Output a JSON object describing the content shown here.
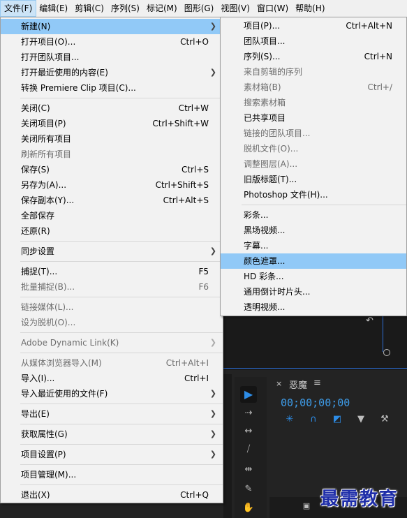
{
  "menubar": [
    {
      "label": "文件(F)",
      "active": true
    },
    {
      "label": "编辑(E)"
    },
    {
      "label": "剪辑(C)"
    },
    {
      "label": "序列(S)"
    },
    {
      "label": "标记(M)"
    },
    {
      "label": "图形(G)"
    },
    {
      "label": "视图(V)"
    },
    {
      "label": "窗口(W)"
    },
    {
      "label": "帮助(H)"
    }
  ],
  "file_menu": {
    "new": {
      "label": "新建(N)"
    },
    "open_project": {
      "label": "打开项目(O)...",
      "shortcut": "Ctrl+O"
    },
    "open_team_project": {
      "label": "打开团队项目..."
    },
    "open_recent": {
      "label": "打开最近使用的内容(E)"
    },
    "convert_clip": {
      "label": "转换 Premiere Clip 项目(C)..."
    },
    "close": {
      "label": "关闭(C)",
      "shortcut": "Ctrl+W"
    },
    "close_project": {
      "label": "关闭项目(P)",
      "shortcut": "Ctrl+Shift+W"
    },
    "close_all_projects": {
      "label": "关闭所有项目"
    },
    "refresh_all_projects": {
      "label": "刷新所有项目"
    },
    "save": {
      "label": "保存(S)",
      "shortcut": "Ctrl+S"
    },
    "save_as": {
      "label": "另存为(A)...",
      "shortcut": "Ctrl+Shift+S"
    },
    "save_copy": {
      "label": "保存副本(Y)...",
      "shortcut": "Ctrl+Alt+S"
    },
    "save_all": {
      "label": "全部保存"
    },
    "revert": {
      "label": "还原(R)"
    },
    "sync_settings": {
      "label": "同步设置"
    },
    "capture": {
      "label": "捕捉(T)...",
      "shortcut": "F5"
    },
    "batch_capture": {
      "label": "批量捕捉(B)...",
      "shortcut": "F6"
    },
    "link_media": {
      "label": "链接媒体(L)..."
    },
    "make_offline": {
      "label": "设为脱机(O)..."
    },
    "dynamic_link": {
      "label": "Adobe Dynamic Link(K)"
    },
    "import_media_browser": {
      "label": "从媒体浏览器导入(M)",
      "shortcut": "Ctrl+Alt+I"
    },
    "import": {
      "label": "导入(I)...",
      "shortcut": "Ctrl+I"
    },
    "import_recent": {
      "label": "导入最近使用的文件(F)"
    },
    "export": {
      "label": "导出(E)"
    },
    "get_properties": {
      "label": "获取属性(G)"
    },
    "project_settings": {
      "label": "项目设置(P)"
    },
    "project_manager": {
      "label": "项目管理(M)..."
    },
    "exit": {
      "label": "退出(X)",
      "shortcut": "Ctrl+Q"
    }
  },
  "new_submenu": {
    "project": {
      "label": "项目(P)...",
      "shortcut": "Ctrl+Alt+N"
    },
    "team_project": {
      "label": "团队项目..."
    },
    "sequence": {
      "label": "序列(S)...",
      "shortcut": "Ctrl+N"
    },
    "sequence_from_clip": {
      "label": "来自剪辑的序列"
    },
    "bin": {
      "label": "素材箱(B)",
      "shortcut": "Ctrl+/"
    },
    "search_bin": {
      "label": "搜索素材箱"
    },
    "shared_project": {
      "label": "已共享项目"
    },
    "linked_team_project": {
      "label": "链接的团队项目..."
    },
    "offline_file": {
      "label": "脱机文件(O)..."
    },
    "adjustment_layer": {
      "label": "调整图层(A)..."
    },
    "legacy_title": {
      "label": "旧版标题(T)..."
    },
    "photoshop_file": {
      "label": "Photoshop 文件(H)..."
    },
    "bars_tone": {
      "label": "彩条..."
    },
    "black_video": {
      "label": "黑场视频..."
    },
    "captions": {
      "label": "字幕..."
    },
    "color_matte": {
      "label": "颜色遮罩..."
    },
    "hd_bars": {
      "label": "HD 彩条..."
    },
    "countdown": {
      "label": "通用倒计时片头..."
    },
    "transparent_video": {
      "label": "透明视频..."
    }
  },
  "timeline": {
    "close_glyph": "×",
    "sequence_name": "恶魔",
    "menu_glyph": "≡",
    "timecode": "00;00;00;00"
  },
  "tools_panel": {
    "tools": [
      "selection-icon",
      "track-select-icon",
      "ripple-edit-icon",
      "razor-icon",
      "slip-icon",
      "pen-icon",
      "hand-icon"
    ]
  },
  "watermark": "最需教育",
  "colors": {
    "highlight": "#91c9f7",
    "accent": "#2d8ce6",
    "menu_bg": "#f2f2f2"
  }
}
